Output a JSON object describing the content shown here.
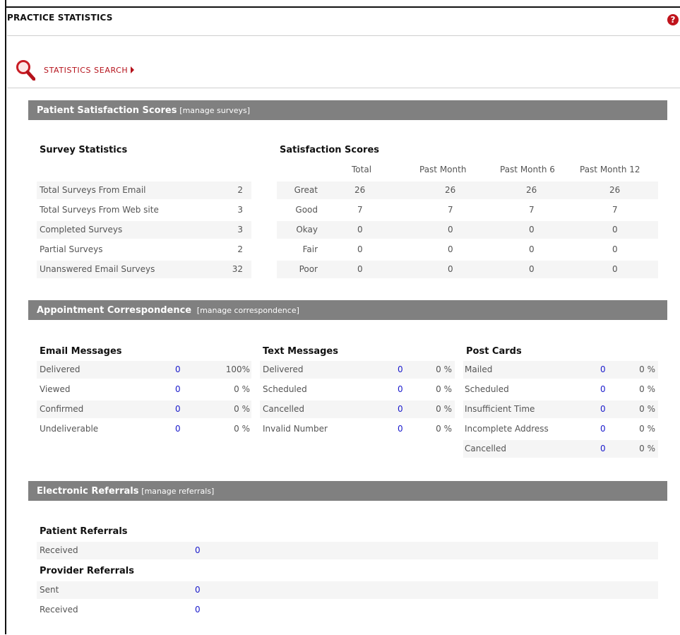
{
  "header": {
    "title": "PRACTICE STATISTICS",
    "help_icon": "help-icon",
    "help_symbol": "?"
  },
  "search": {
    "label": "STATISTICS SEARCH",
    "icon": "magnifier-icon"
  },
  "satisfaction": {
    "title": "Patient Satisfaction Scores",
    "manage_link": "[manage surveys]",
    "survey_heading": "Survey Statistics",
    "scores_heading": "Satisfaction Scores",
    "columns": [
      "Total",
      "Past Month",
      "Past Month 6",
      "Past Month 12"
    ],
    "survey_stats": [
      {
        "label": "Total Surveys From Email",
        "value": "2"
      },
      {
        "label": "Total Surveys From Web site",
        "value": "3"
      },
      {
        "label": "Completed Surveys",
        "value": "3"
      },
      {
        "label": "Partial Surveys",
        "value": "2"
      },
      {
        "label": "Unanswered Email Surveys",
        "value": "32"
      }
    ],
    "scores": [
      {
        "label": "Great",
        "values": [
          "26",
          "26",
          "26",
          "26"
        ]
      },
      {
        "label": "Good",
        "values": [
          "7",
          "7",
          "7",
          "7"
        ]
      },
      {
        "label": "Okay",
        "values": [
          "0",
          "0",
          "0",
          "0"
        ]
      },
      {
        "label": "Fair",
        "values": [
          "0",
          "0",
          "0",
          "0"
        ]
      },
      {
        "label": "Poor",
        "values": [
          "0",
          "0",
          "0",
          "0"
        ]
      }
    ]
  },
  "correspondence": {
    "title": "Appointment Correspondence",
    "manage_link": "[manage correspondence]",
    "email": {
      "heading": "Email Messages",
      "rows": [
        {
          "label": "Delivered",
          "count": "0",
          "pct": "100%"
        },
        {
          "label": "Viewed",
          "count": "0",
          "pct": "0 %"
        },
        {
          "label": "Confirmed",
          "count": "0",
          "pct": "0 %"
        },
        {
          "label": "Undeliverable",
          "count": "0",
          "pct": "0 %"
        }
      ]
    },
    "text": {
      "heading": "Text Messages",
      "rows": [
        {
          "label": "Delivered",
          "count": "0",
          "pct": "0 %"
        },
        {
          "label": "Scheduled",
          "count": "0",
          "pct": "0 %"
        },
        {
          "label": "Cancelled",
          "count": "0",
          "pct": "0 %"
        },
        {
          "label": "Invalid Number",
          "count": "0",
          "pct": "0 %"
        }
      ]
    },
    "post": {
      "heading": "Post Cards",
      "rows": [
        {
          "label": "Mailed",
          "count": "0",
          "pct": "0 %"
        },
        {
          "label": "Scheduled",
          "count": "0",
          "pct": "0 %"
        },
        {
          "label": "Insufficient Time",
          "count": "0",
          "pct": "0 %"
        },
        {
          "label": "Incomplete Address",
          "count": "0",
          "pct": "0 %"
        },
        {
          "label": "Cancelled",
          "count": "0",
          "pct": "0 %"
        }
      ]
    }
  },
  "referrals": {
    "title": "Electronic Referrals",
    "manage_link": "[manage referrals]",
    "patient_heading": "Patient Referrals",
    "patient_rows": [
      {
        "label": "Received",
        "value": "0"
      }
    ],
    "provider_heading": "Provider Referrals",
    "provider_rows": [
      {
        "label": "Sent",
        "value": "0"
      },
      {
        "label": "Received",
        "value": "0"
      }
    ]
  }
}
